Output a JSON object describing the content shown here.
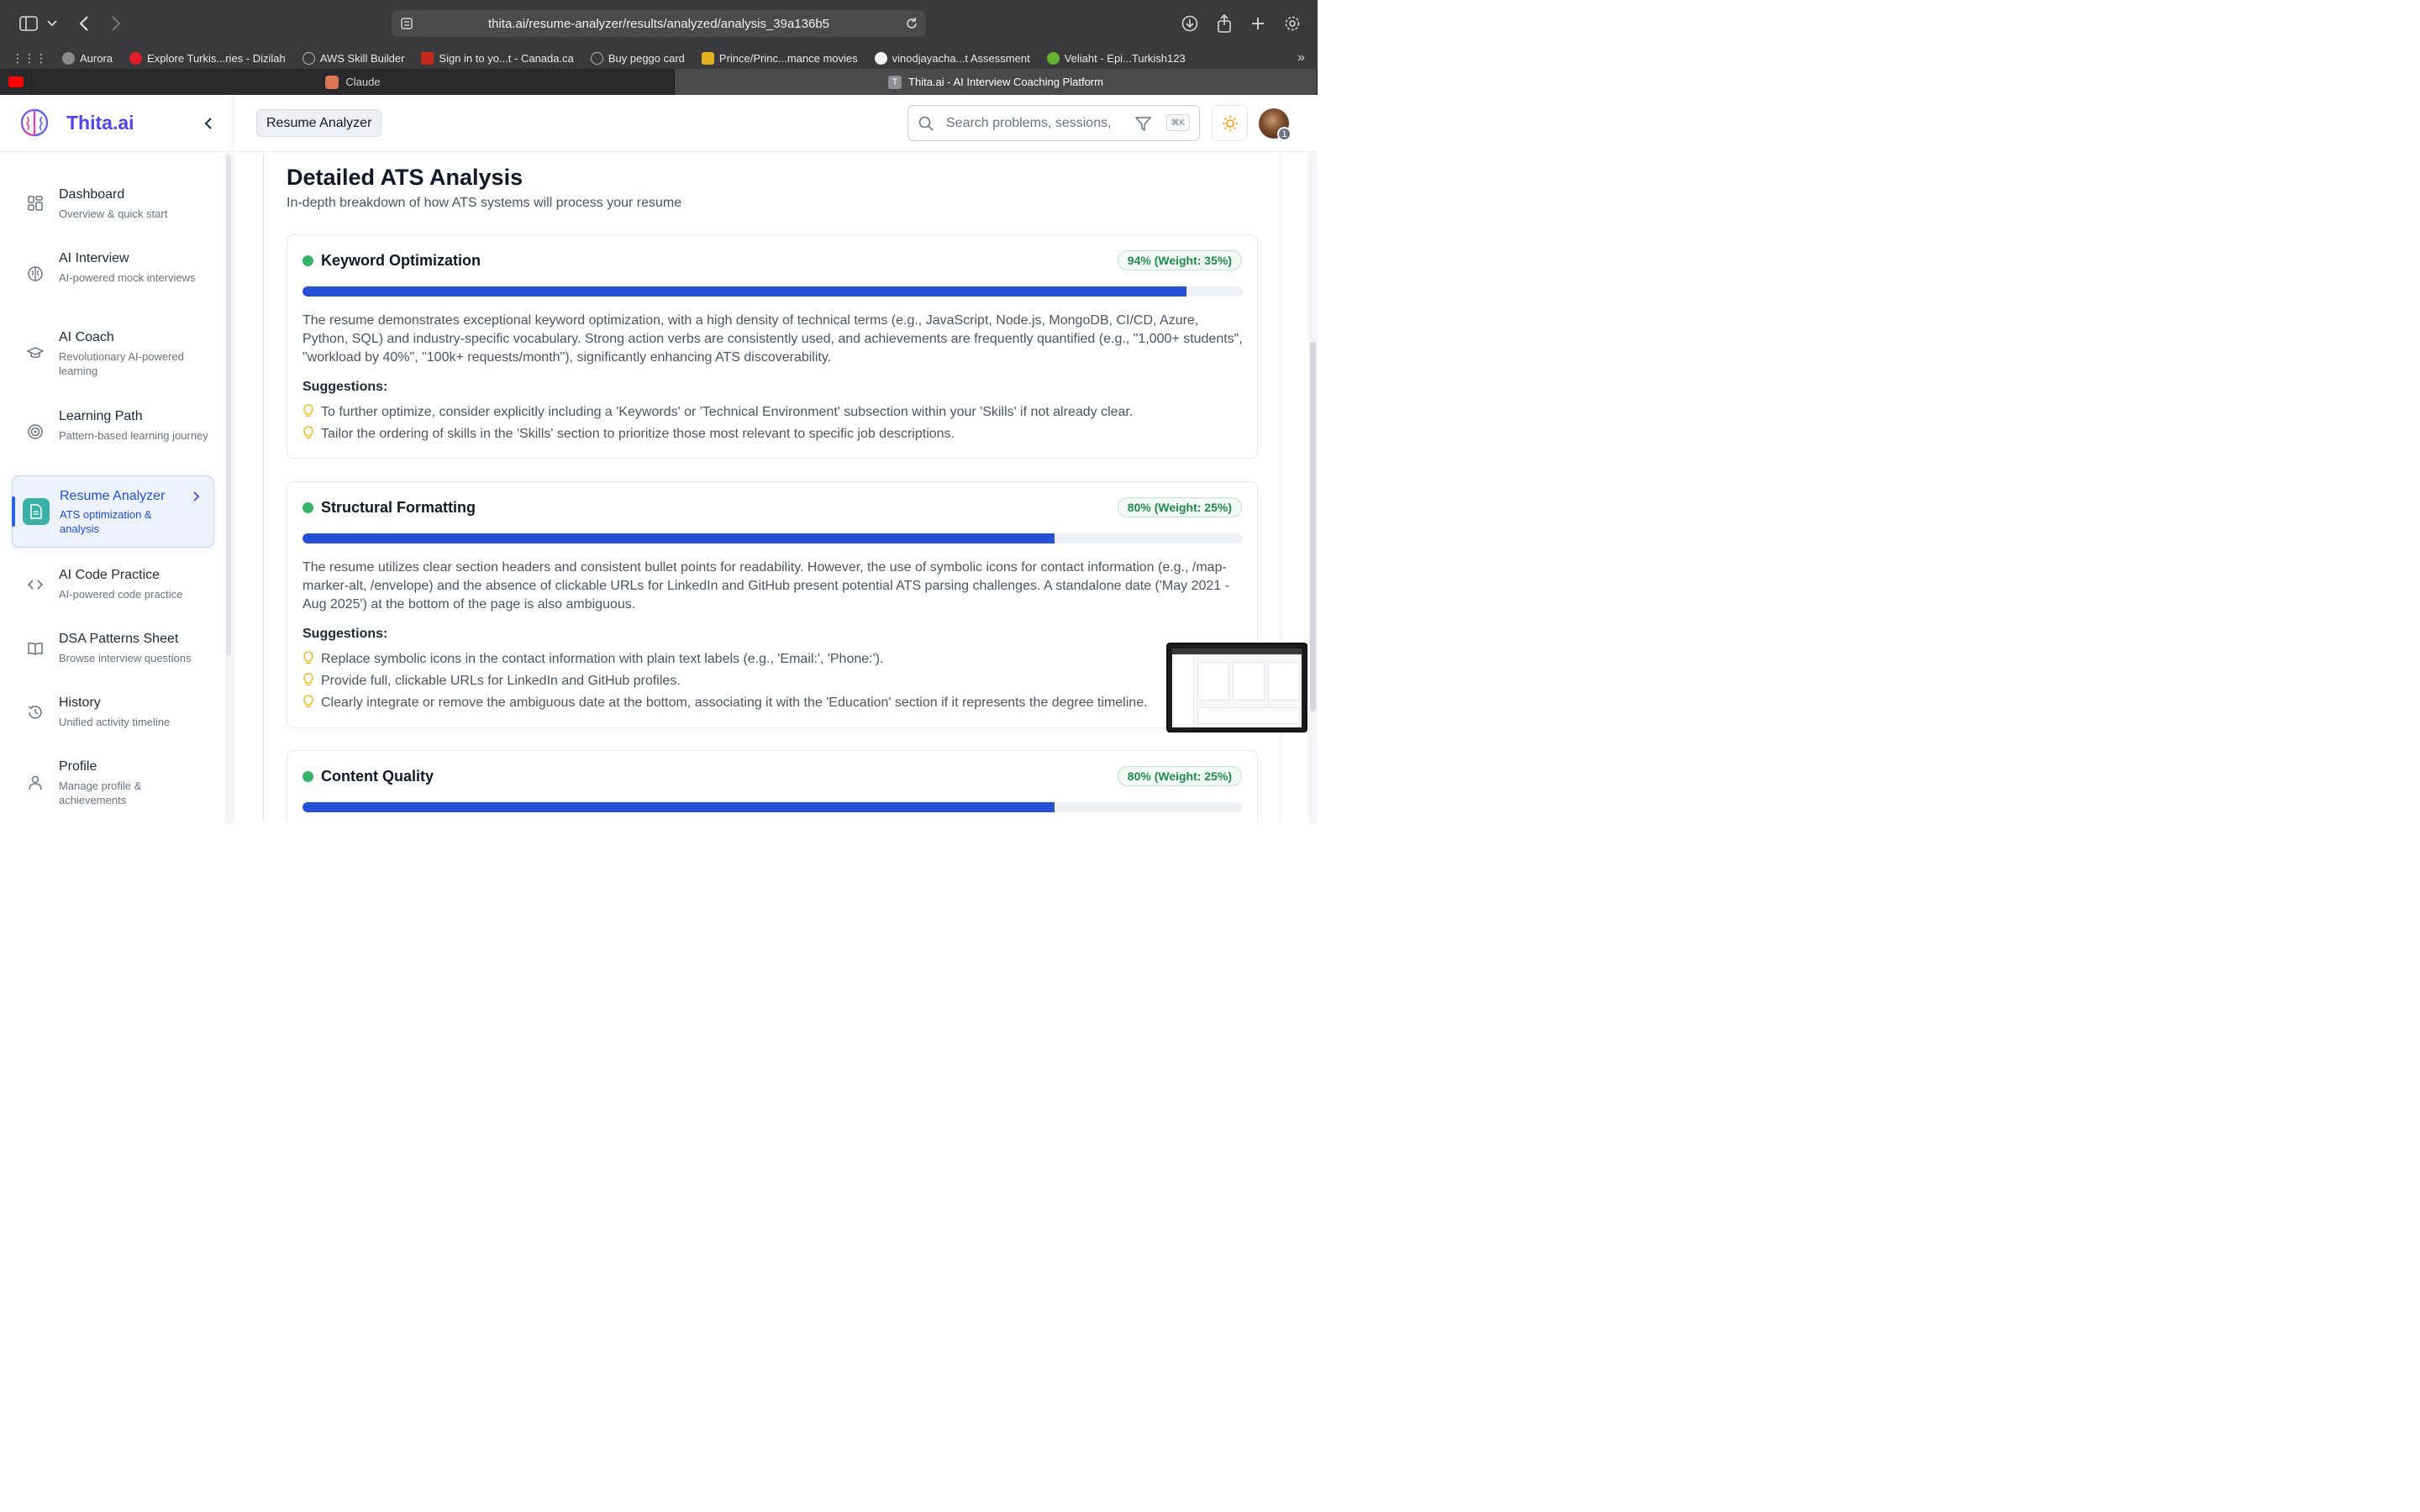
{
  "browser": {
    "url": "thita.ai/resume-analyzer/results/analyzed/analysis_39a136b5",
    "bookmarks": [
      {
        "label": "Aurora",
        "color": "#8a8a8e"
      },
      {
        "label": "Explore Turkis...ries - Dizilah",
        "color": "#e11d2e"
      },
      {
        "label": "AWS Skill Builder",
        "color": "#9ca3af"
      },
      {
        "label": "Sign in to yo...t - Canada.ca",
        "color": "#c2281d"
      },
      {
        "label": "Buy peggo card",
        "color": "#9ca3af"
      },
      {
        "label": "Prince/Princ...mance movies",
        "color": "#e3b021"
      },
      {
        "label": "vinodjayacha...t Assessment",
        "color": "#f3f4f6"
      },
      {
        "label": "Veliaht - Epi...Turkish123",
        "color": "#65b32e"
      }
    ],
    "tabs": [
      {
        "label": "",
        "color": "#ff0000"
      },
      {
        "label": "Claude",
        "color": "#d97757"
      },
      {
        "label": "Thita.ai - AI Interview Coaching Platform",
        "color": "#8e8e93",
        "fav_letter": "T"
      }
    ]
  },
  "header": {
    "brand": "Thita.ai",
    "page_chip": "Resume Analyzer",
    "search_placeholder": "Search problems, sessions,",
    "kbd_hint": "⌘K",
    "avatar_badge": "1"
  },
  "sidebar": {
    "items": [
      {
        "title": "Dashboard",
        "sub": "Overview & quick start",
        "icon": "dashboard-icon"
      },
      {
        "title": "AI Interview",
        "sub": "AI-powered mock interviews",
        "icon": "brain-icon"
      },
      {
        "title": "AI Coach",
        "sub": "Revolutionary AI-powered learning",
        "icon": "graduation-cap-icon"
      },
      {
        "title": "Learning Path",
        "sub": "Pattern-based learning journey",
        "icon": "target-icon"
      },
      {
        "title": "Resume Analyzer",
        "sub": "ATS optimization & analysis",
        "icon": "document-icon"
      },
      {
        "title": "AI Code Practice",
        "sub": "AI-powered code practice",
        "icon": "code-icon"
      },
      {
        "title": "DSA Patterns Sheet",
        "sub": "Browse interview questions",
        "icon": "book-icon"
      },
      {
        "title": "History",
        "sub": "Unified activity timeline",
        "icon": "history-icon"
      },
      {
        "title": "Profile",
        "sub": "Manage profile & achievements",
        "icon": "user-icon"
      }
    ]
  },
  "main": {
    "title": "Detailed ATS Analysis",
    "subtitle": "In-depth breakdown of how ATS systems will process your resume",
    "suggestions_heading": "Suggestions:",
    "metrics": [
      {
        "title": "Keyword Optimization",
        "score": 94,
        "badge": "94% (Weight: 35%)",
        "desc": "The resume demonstrates exceptional keyword optimization, with a high density of technical terms (e.g., JavaScript, Node.js, MongoDB, CI/CD, Azure, Python, SQL) and industry-specific vocabulary. Strong action verbs are consistently used, and achievements are frequently quantified (e.g., \"1,000+ students\", \"workload by 40%\", \"100k+ requests/month\"), significantly enhancing ATS discoverability.",
        "suggestions": [
          "To further optimize, consider explicitly including a 'Keywords' or 'Technical Environment' subsection within your 'Skills' if not already clear.",
          "Tailor the ordering of skills in the 'Skills' section to prioritize those most relevant to specific job descriptions."
        ]
      },
      {
        "title": "Structural Formatting",
        "score": 80,
        "badge": "80% (Weight: 25%)",
        "desc": "The resume utilizes clear section headers and consistent bullet points for readability. However, the use of symbolic icons for contact information (e.g., /map-marker-alt, /envelope) and the absence of clickable URLs for LinkedIn and GitHub present potential ATS parsing challenges. A standalone date ('May 2021 - Aug 2025') at the bottom of the page is also ambiguous.",
        "suggestions": [
          "Replace symbolic icons in the contact information with plain text labels (e.g., 'Email:', 'Phone:').",
          "Provide full, clickable URLs for LinkedIn and GitHub profiles.",
          "Clearly integrate or remove the ambiguous date at the bottom, associating it with the 'Education' section if it represents the degree timeline."
        ]
      },
      {
        "title": "Content Quality",
        "score": 80,
        "badge": "80% (Weight: 25%)",
        "desc": "",
        "suggestions": []
      }
    ]
  }
}
